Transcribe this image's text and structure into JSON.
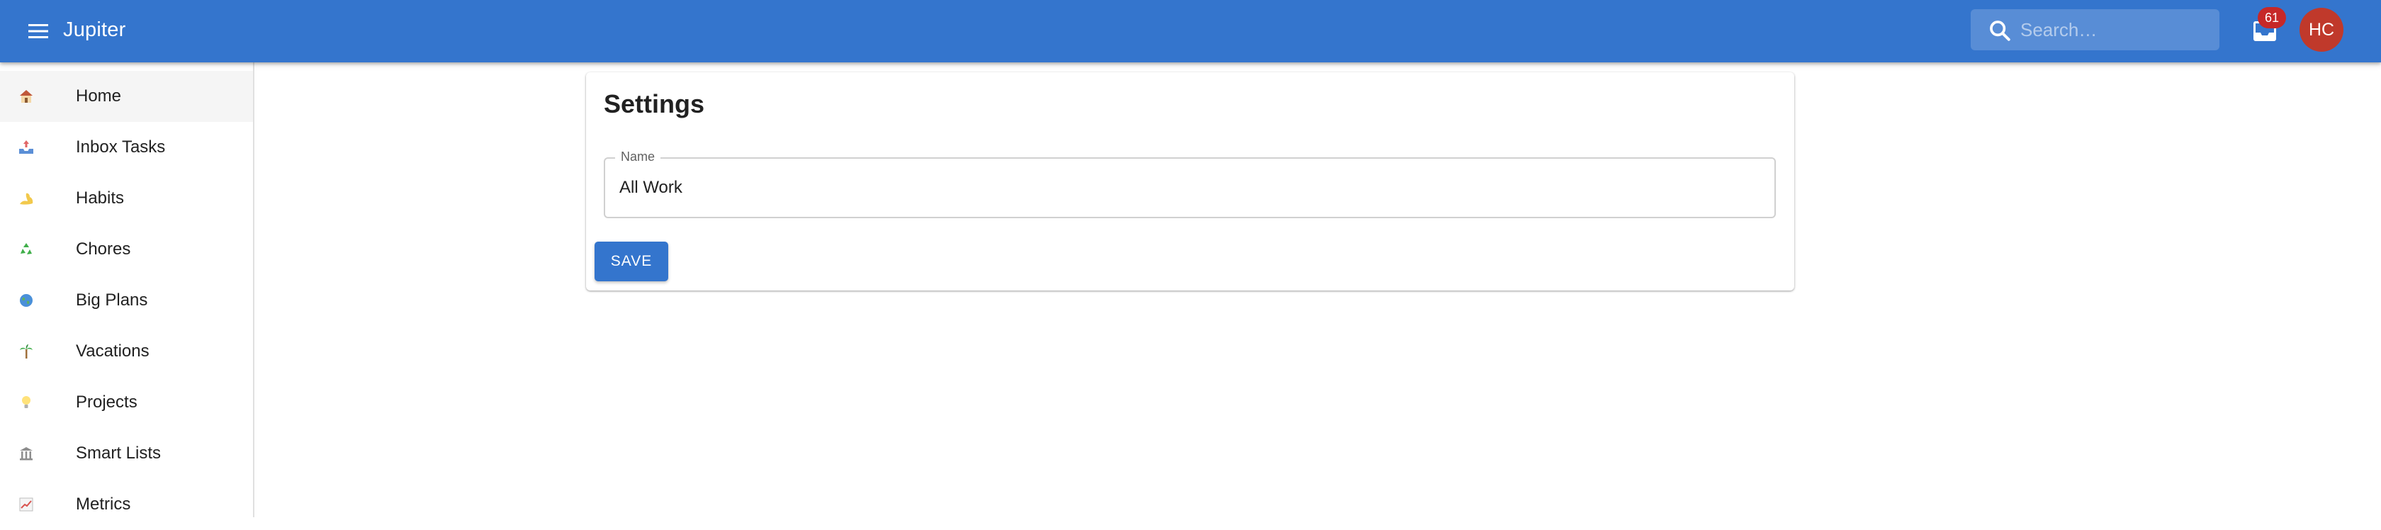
{
  "app": {
    "title": "Jupiter",
    "menu_icon": "menu-icon"
  },
  "search": {
    "placeholder": "Search…",
    "icon": "search-icon"
  },
  "inbox": {
    "icon": "inbox-icon",
    "badge_count": "61"
  },
  "user": {
    "initials": "HC"
  },
  "sidebar": {
    "items": [
      {
        "label": "Home",
        "icon": "house-icon",
        "active": true
      },
      {
        "label": "Inbox Tasks",
        "icon": "inbox-tray-icon"
      },
      {
        "label": "Habits",
        "icon": "flexed-arm-icon"
      },
      {
        "label": "Chores",
        "icon": "recycle-icon"
      },
      {
        "label": "Big Plans",
        "icon": "globe-icon"
      },
      {
        "label": "Vacations",
        "icon": "palm-tree-icon"
      },
      {
        "label": "Projects",
        "icon": "light-bulb-icon"
      },
      {
        "label": "Smart Lists",
        "icon": "building-icon"
      },
      {
        "label": "Metrics",
        "icon": "chart-increasing-icon"
      }
    ]
  },
  "settings": {
    "title": "Settings",
    "name_field": {
      "label": "Name",
      "value": "All Work"
    },
    "save_label": "SAVE"
  },
  "colors": {
    "primary": "#3475cd",
    "badge": "#c62828",
    "avatar": "#c0392b"
  }
}
